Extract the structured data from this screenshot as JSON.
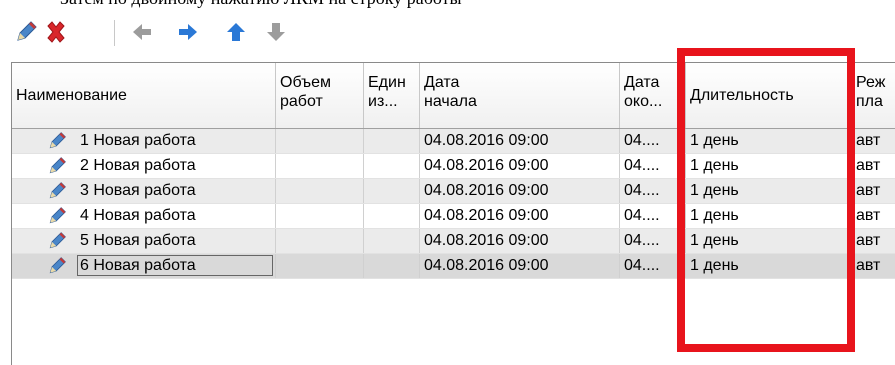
{
  "top_text": "Затем по двойному нажатию ЛКМ на строку работы",
  "toolbar": {
    "buttons": [
      {
        "name": "edit-work-button",
        "icon": "pencil-icon"
      },
      {
        "name": "delete-work-button",
        "icon": "delete-x-icon"
      },
      {
        "name": "move-left-button",
        "icon": "arrow-left-icon"
      },
      {
        "name": "move-right-button",
        "icon": "arrow-right-icon"
      },
      {
        "name": "move-up-button",
        "icon": "arrow-up-icon"
      },
      {
        "name": "move-down-button",
        "icon": "arrow-down-icon"
      }
    ],
    "colors": {
      "arrow_active": "#2a78d6",
      "arrow_disabled": "#9c9c9c",
      "delete": "#d9262b"
    }
  },
  "grid": {
    "columns": [
      {
        "key": "name",
        "label": "Наименование"
      },
      {
        "key": "volume",
        "label": "Объем\nработ"
      },
      {
        "key": "unit",
        "label": "Един\nиз..."
      },
      {
        "key": "start",
        "label": "Дата\nначала"
      },
      {
        "key": "end",
        "label": "Дата\nоко..."
      },
      {
        "key": "duration",
        "label": "Длительность"
      },
      {
        "key": "mode",
        "label": "Реж\nпла"
      }
    ],
    "rows": [
      {
        "name": "1 Новая работа",
        "volume": "",
        "unit": "",
        "start": "04.08.2016 09:00",
        "end": "04....",
        "duration": "1 день",
        "mode": "авт"
      },
      {
        "name": "2 Новая работа",
        "volume": "",
        "unit": "",
        "start": "04.08.2016 09:00",
        "end": "04....",
        "duration": "1 день",
        "mode": "авт"
      },
      {
        "name": "3 Новая работа",
        "volume": "",
        "unit": "",
        "start": "04.08.2016 09:00",
        "end": "04....",
        "duration": "1 день",
        "mode": "авт"
      },
      {
        "name": "4 Новая работа",
        "volume": "",
        "unit": "",
        "start": "04.08.2016 09:00",
        "end": "04....",
        "duration": "1 день",
        "mode": "авт"
      },
      {
        "name": "5 Новая работа",
        "volume": "",
        "unit": "",
        "start": "04.08.2016 09:00",
        "end": "04....",
        "duration": "1 день",
        "mode": "авт"
      },
      {
        "name": "6 Новая работа",
        "volume": "",
        "unit": "",
        "start": "04.08.2016 09:00",
        "end": "04....",
        "duration": "1 день",
        "mode": "авт"
      }
    ],
    "selected_row": 6
  },
  "highlight": {
    "target_column": "Длительность",
    "color": "#e8141c"
  }
}
